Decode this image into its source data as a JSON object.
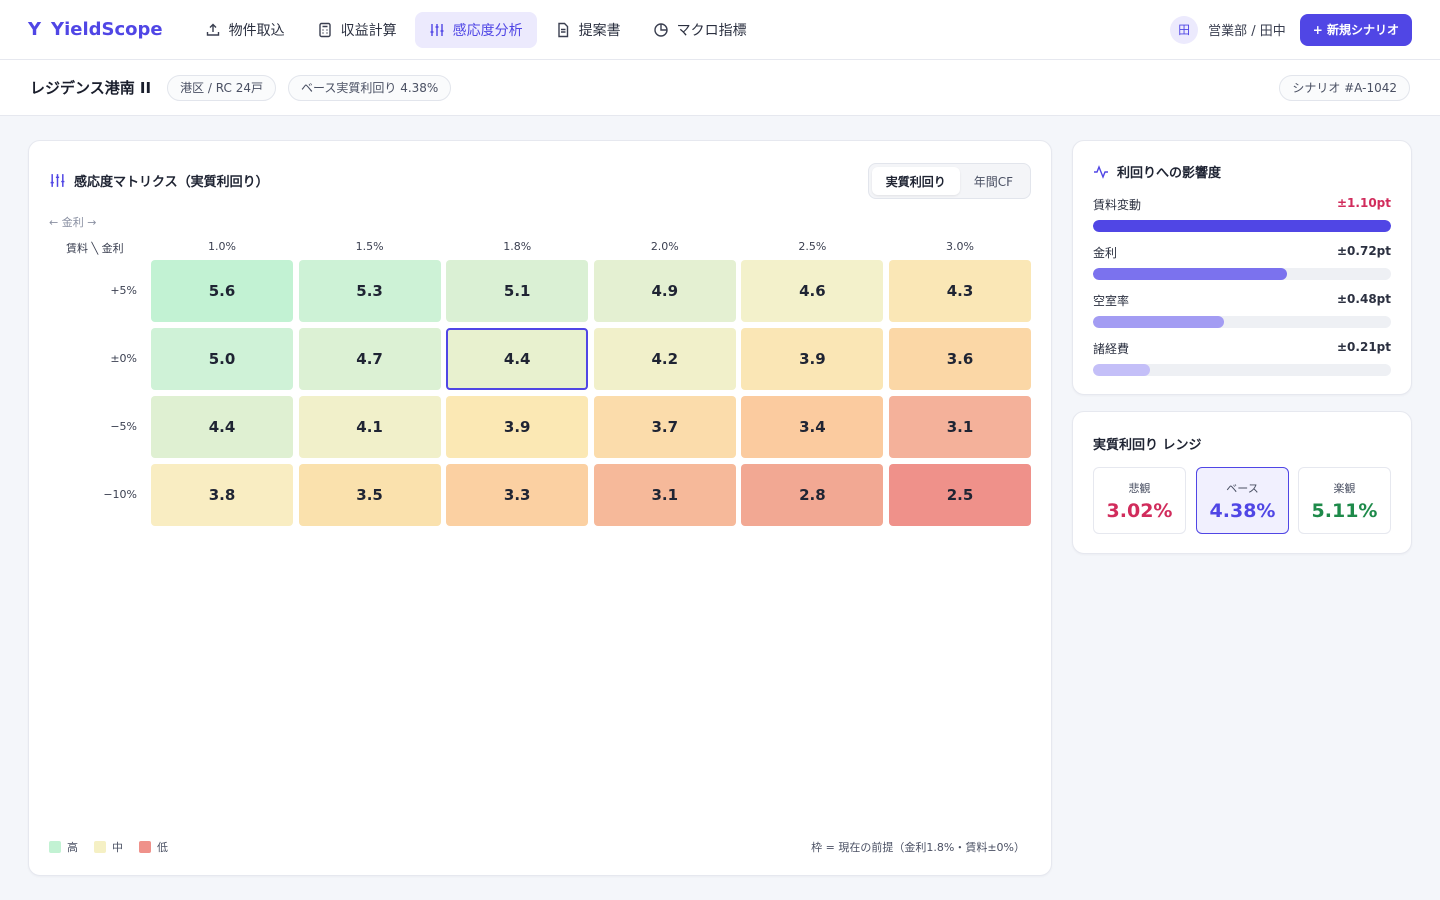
{
  "app": {
    "name": "YieldScope",
    "logo_mark": "Y"
  },
  "nav": [
    {
      "label": "物件取込",
      "icon": "upload-icon"
    },
    {
      "label": "収益計算",
      "icon": "calculator-icon"
    },
    {
      "label": "感応度分析",
      "icon": "sliders-icon",
      "active": true
    },
    {
      "label": "提案書",
      "icon": "document-icon"
    },
    {
      "label": "マクロ指標",
      "icon": "pie-chart-icon"
    }
  ],
  "user": {
    "avatar": "田",
    "label": "営業部 / 田中"
  },
  "new_scenario_label": "+ 新規シナリオ",
  "property": {
    "name": "レジデンス港南 II",
    "location_chip": "港区 / RC 24戸",
    "yield_chip": "ベース実質利回り 4.38%",
    "scenario_chip": "シナリオ #A-1042"
  },
  "matrix": {
    "title": "感応度マトリクス（実質利回り）",
    "toggle": [
      "実質利回り",
      "年間CF"
    ],
    "toggle_active": 0,
    "axis_hint": "← 金利 →",
    "corner": "賃料 ╲ 金利",
    "columns": [
      "1.0%",
      "1.5%",
      "1.8%",
      "2.0%",
      "2.5%",
      "3.0%"
    ],
    "rows": [
      {
        "label": "+5%",
        "values": [
          "5.6",
          "5.3",
          "5.1",
          "4.9",
          "4.6",
          "4.3"
        ],
        "colors": [
          "#c2f2d3",
          "#cdf2d6",
          "#daf0d4",
          "#e4f0d2",
          "#f3f1cb",
          "#fae7b6"
        ]
      },
      {
        "label": "±0%",
        "values": [
          "5.0",
          "4.7",
          "4.4",
          "4.2",
          "3.9",
          "3.6"
        ],
        "colors": [
          "#cff2d7",
          "#dcf1d4",
          "#e8f1cf",
          "#f1f0ca",
          "#fae6b5",
          "#fbd7a6"
        ]
      },
      {
        "label": "−5%",
        "values": [
          "4.4",
          "4.1",
          "3.9",
          "3.7",
          "3.4",
          "3.1"
        ],
        "colors": [
          "#dff0d2",
          "#f1f0ca",
          "#fbe8b4",
          "#fbdcab",
          "#fbcb9f",
          "#f4b19a"
        ]
      },
      {
        "label": "−10%",
        "values": [
          "3.8",
          "3.5",
          "3.3",
          "3.1",
          "2.8",
          "2.5"
        ],
        "colors": [
          "#f9edc2",
          "#fae1ad",
          "#fbd0a2",
          "#f6b99a",
          "#f2a893",
          "#ef918a"
        ]
      }
    ],
    "selected": {
      "row": 1,
      "col": 2
    },
    "legend": [
      {
        "label": "高",
        "color": "#c2f2d3"
      },
      {
        "label": "中",
        "color": "#f5f0c4"
      },
      {
        "label": "低",
        "color": "#ef918a"
      }
    ],
    "footnote": "枠 = 現在の前提（金利1.8%・賃料±0%）"
  },
  "impact": {
    "title": "利回りへの影響度",
    "items": [
      {
        "label": "賃料変動",
        "value": "±1.10pt",
        "value_color": "#d12c5c",
        "fraction": 1.0,
        "color": "#5046e5"
      },
      {
        "label": "金利",
        "value": "±0.72pt",
        "value_color": "#2b3040",
        "fraction": 0.65,
        "color": "#7b72ee"
      },
      {
        "label": "空室率",
        "value": "±0.48pt",
        "value_color": "#2b3040",
        "fraction": 0.44,
        "color": "#a39cf3"
      },
      {
        "label": "諸経費",
        "value": "±0.21pt",
        "value_color": "#2b3040",
        "fraction": 0.19,
        "color": "#c4bff8"
      }
    ]
  },
  "range": {
    "title": "実質利回り レンジ",
    "items": [
      {
        "label": "悲観",
        "value": "3.02%",
        "color": "#d12c5c"
      },
      {
        "label": "ベース",
        "value": "4.38%",
        "color": "#5046e5"
      },
      {
        "label": "楽観",
        "value": "5.11%",
        "color": "#1e8a4a"
      }
    ]
  }
}
